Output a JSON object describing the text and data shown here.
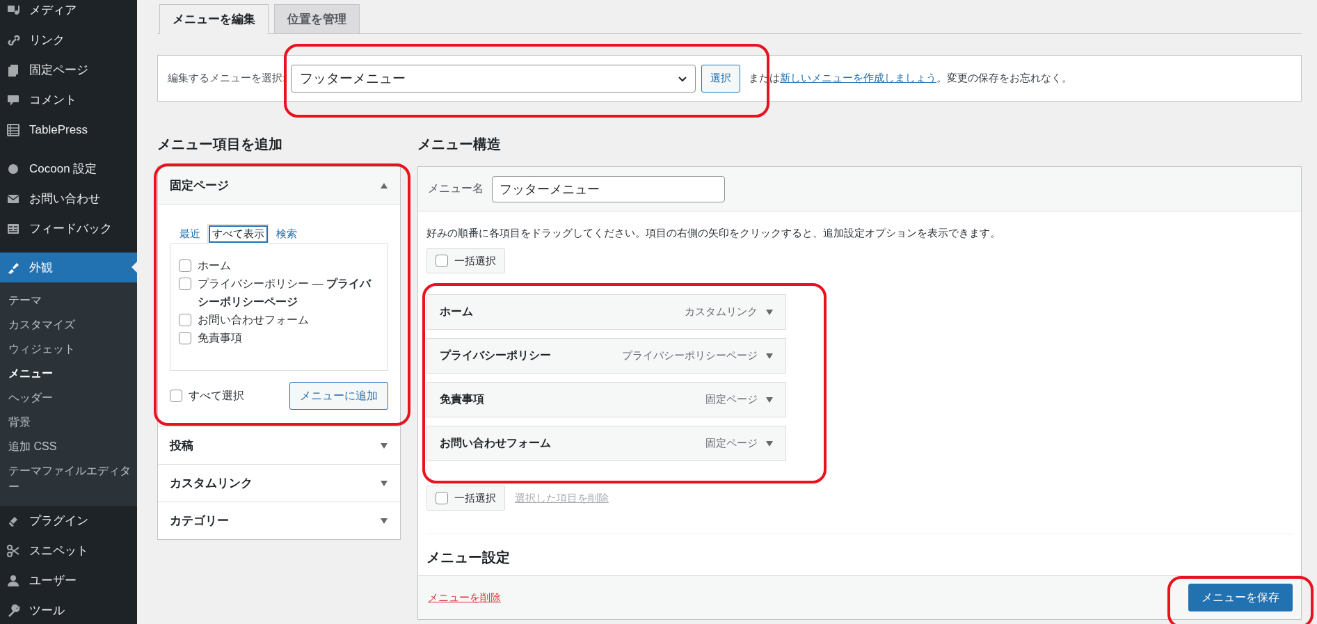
{
  "sidebar": {
    "groups": [
      [
        {
          "label": "メディア",
          "selected": false
        },
        {
          "label": "リンク",
          "selected": false
        },
        {
          "label": "固定ページ",
          "selected": false
        },
        {
          "label": "コメント",
          "selected": false
        },
        {
          "label": "TablePress",
          "selected": false
        }
      ],
      [
        {
          "label": "Cocoon 設定",
          "selected": false
        },
        {
          "label": "お問い合わせ",
          "selected": false
        },
        {
          "label": "フィードバック",
          "selected": false
        }
      ],
      [
        {
          "label": "外観",
          "selected": true,
          "children": [
            {
              "label": "テーマ",
              "selected": false
            },
            {
              "label": "カスタマイズ",
              "selected": false
            },
            {
              "label": "ウィジェット",
              "selected": false
            },
            {
              "label": "メニュー",
              "selected": true
            },
            {
              "label": "ヘッダー",
              "selected": false
            },
            {
              "label": "背景",
              "selected": false
            },
            {
              "label": "追加 CSS",
              "selected": false
            },
            {
              "label": "テーマファイルエディター",
              "selected": false
            }
          ]
        },
        {
          "label": "プラグイン",
          "selected": false
        },
        {
          "label": "スニペット",
          "selected": false
        },
        {
          "label": "ユーザー",
          "selected": false
        },
        {
          "label": "ツール",
          "selected": false
        }
      ]
    ]
  },
  "tabs": [
    {
      "label": "メニューを編集",
      "selected": true
    },
    {
      "label": "位置を管理",
      "selected": false
    }
  ],
  "menu_select": {
    "label": "編集するメニューを選択:",
    "value": "フッターメニュー",
    "button": "選択",
    "text_before": "または",
    "link": "新しいメニューを作成しましょう",
    "text_after": "。変更の保存をお忘れなく。"
  },
  "add_items": {
    "heading": "メニュー項目を追加",
    "panels": [
      {
        "title": "固定ページ",
        "expanded": true,
        "tabs": [
          {
            "label": "最近",
            "selected": false
          },
          {
            "label": "すべて表示",
            "selected": true
          },
          {
            "label": "検索",
            "selected": false
          }
        ],
        "items": [
          {
            "label": "ホーム",
            "checked": false
          },
          {
            "label": "プライバシーポリシー — **プライバシーポリシーページ**",
            "checked": false
          },
          {
            "label": "お問い合わせフォーム",
            "checked": false
          },
          {
            "label": "免責事項",
            "checked": false
          }
        ],
        "select_all": {
          "label": "すべて選択",
          "checked": false
        },
        "button": "メニューに追加"
      },
      {
        "title": "投稿",
        "expanded": false
      },
      {
        "title": "カスタムリンク",
        "expanded": false
      },
      {
        "title": "カテゴリー",
        "expanded": false
      }
    ]
  },
  "structure": {
    "heading": "メニュー構造",
    "name_label": "メニュー名",
    "name_value": "フッターメニュー",
    "instructions": "好みの順番に各項目をドラッグしてください。項目の右側の矢印をクリックすると、追加設定オプションを表示できます。",
    "bulk_select": {
      "label": "一括選択",
      "checked": false
    },
    "items": [
      {
        "title": "ホーム",
        "type": "カスタムリンク"
      },
      {
        "title": "プライバシーポリシー",
        "type": "プライバシーポリシーページ"
      },
      {
        "title": "免責事項",
        "type": "固定ページ"
      },
      {
        "title": "お問い合わせフォーム",
        "type": "固定ページ"
      }
    ],
    "bulk_select_bottom": {
      "label": "一括選択",
      "checked": false
    },
    "delete_selected": "選択した項目を削除",
    "settings_heading": "メニュー設定",
    "delete_menu": "メニューを削除",
    "save": "メニューを保存"
  }
}
